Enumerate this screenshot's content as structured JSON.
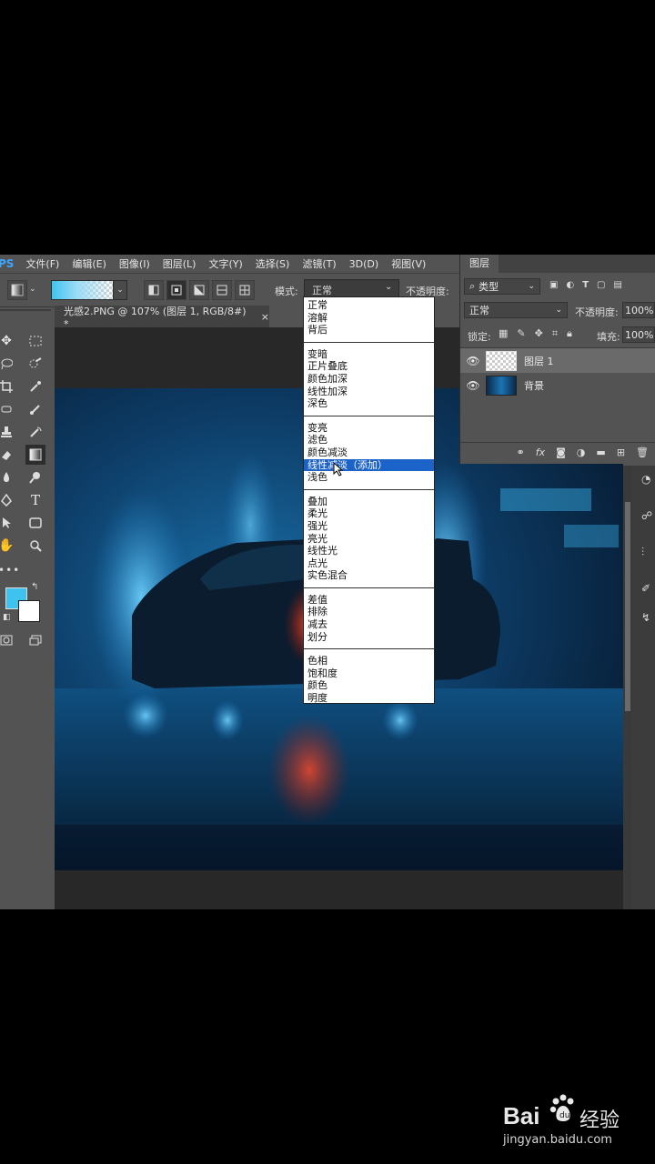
{
  "menu": {
    "app_logo": "PS",
    "items": [
      "文件(F)",
      "编辑(E)",
      "图像(I)",
      "图层(L)",
      "文字(Y)",
      "选择(S)",
      "滤镜(T)",
      "3D(D)",
      "视图(V)"
    ]
  },
  "options": {
    "mode_label": "模式:",
    "mode_value": "正常",
    "opacity_label": "不透明度:"
  },
  "document": {
    "tab_title": "光感2.PNG @ 107% (图层 1, RGB/8#) *",
    "tab_close": "×"
  },
  "blend_dropdown": {
    "groups": [
      [
        "正常",
        "溶解",
        "背后"
      ],
      [
        "变暗",
        "正片叠底",
        "颜色加深",
        "线性加深",
        "深色"
      ],
      [
        "变亮",
        "滤色",
        "颜色减淡",
        "线性减淡（添加）",
        "浅色"
      ],
      [
        "叠加",
        "柔光",
        "强光",
        "亮光",
        "线性光",
        "点光",
        "实色混合"
      ],
      [
        "差值",
        "排除",
        "减去",
        "划分"
      ],
      [
        "色相",
        "饱和度",
        "颜色",
        "明度"
      ]
    ],
    "highlighted": "线性减淡（添加）"
  },
  "layers_panel": {
    "tab_title": "图层",
    "filter_label": "类型",
    "blend_mode": "正常",
    "opacity_label": "不透明度:",
    "opacity_value": "100%",
    "lock_label": "锁定:",
    "fill_label": "填充:",
    "fill_value": "100%",
    "layers": [
      {
        "name": "图层 1",
        "selected": true
      },
      {
        "name": "背景",
        "selected": false
      }
    ],
    "bottom_icons": [
      "link-icon",
      "fx-icon",
      "mask-icon",
      "adjustment-icon",
      "folder-icon",
      "new-layer-icon",
      "trash-icon"
    ],
    "fx_label": "fx"
  },
  "colors": {
    "foreground": "#3fc3ee",
    "background": "#ffffff",
    "ui_bg": "#535353",
    "highlight": "#1c63c9"
  },
  "watermark": {
    "brand_left": "Bai",
    "brand_right": "经验",
    "url": "jingyan.baidu.com"
  }
}
